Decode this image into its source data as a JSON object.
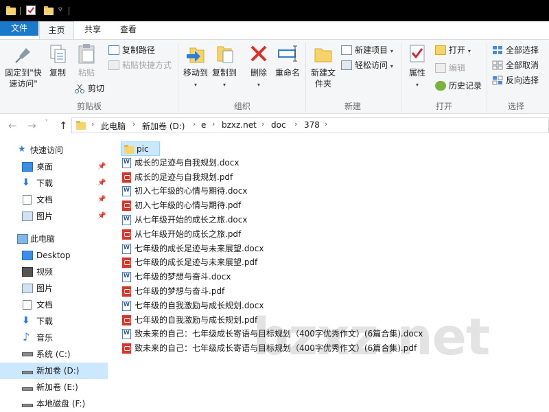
{
  "title_bar": {
    "icons": [
      "folder-icon",
      "properties-check-icon",
      "new-folder-icon",
      "customize-dropdown-icon"
    ]
  },
  "tabs": [
    {
      "label": "文件"
    },
    {
      "label": "主页"
    },
    {
      "label": "共享"
    },
    {
      "label": "查看"
    }
  ],
  "ribbon": {
    "clipboard": {
      "pin_quick_access": "固定到\"快速访问\"",
      "copy": "复制",
      "paste": "粘贴",
      "copy_path": "复制路径",
      "paste_shortcut": "粘贴快捷方式",
      "cut": "剪切",
      "group": "剪贴板"
    },
    "organize": {
      "move_to": "移动到",
      "copy_to": "复制到",
      "delete": "删除",
      "rename": "重命名",
      "group": "组织"
    },
    "new": {
      "new_folder": "新建文件夹",
      "new_item": "新建项目",
      "easy_access": "轻松访问",
      "group": "新建"
    },
    "open": {
      "properties": "属性",
      "open": "打开",
      "edit": "编辑",
      "history": "历史记录",
      "group": "打开"
    },
    "select": {
      "select_all": "全部选择",
      "select_none": "全部取消",
      "invert": "反向选择",
      "group": "选择"
    }
  },
  "address": {
    "back": "←",
    "forward": "→",
    "recent": "˅",
    "up": "↑",
    "crumbs": [
      "此电脑",
      "新加卷 (D:)",
      "e",
      "bzxz.net",
      "doc",
      "378"
    ]
  },
  "nav": {
    "quick_access": "快速访问",
    "desktop": "桌面",
    "downloads": "下载",
    "documents": "文档",
    "pictures": "图片",
    "this_pc": "此电脑",
    "pc_desktop": "Desktop",
    "videos": "视频",
    "pc_pictures": "图片",
    "pc_documents": "文档",
    "pc_downloads": "下载",
    "music": "音乐",
    "drive_c": "系统 (C:)",
    "drive_d": "新加卷 (D:)",
    "drive_e": "新加卷 (E:)",
    "drive_f": "本地磁盘 (F:)"
  },
  "files": [
    {
      "name": "pic",
      "type": "folder"
    },
    {
      "name": "成长的足迹与自我规划.docx",
      "type": "docx"
    },
    {
      "name": "成长的足迹与自我规划.pdf",
      "type": "pdf"
    },
    {
      "name": "初入七年级的心情与期待.docx",
      "type": "docx"
    },
    {
      "name": "初入七年级的心情与期待.pdf",
      "type": "pdf"
    },
    {
      "name": "从七年级开始的成长之旅.docx",
      "type": "docx"
    },
    {
      "name": "从七年级开始的成长之旅.pdf",
      "type": "pdf"
    },
    {
      "name": "七年级的成长足迹与未来展望.docx",
      "type": "docx"
    },
    {
      "name": "七年级的成长足迹与未来展望.pdf",
      "type": "pdf"
    },
    {
      "name": "七年级的梦想与奋斗.docx",
      "type": "docx"
    },
    {
      "name": "七年级的梦想与奋斗.pdf",
      "type": "pdf"
    },
    {
      "name": "七年级的自我激励与成长规划.docx",
      "type": "docx"
    },
    {
      "name": "七年级的自我激励与成长规划.pdf",
      "type": "pdf"
    },
    {
      "name": "致未来的自己：七年级成长寄语与目标规划（400字优秀作文）(6篇合集).docx",
      "type": "docx"
    },
    {
      "name": "致未来的自己：七年级成长寄语与目标规划（400字优秀作文）(6篇合集).pdf",
      "type": "pdf"
    }
  ],
  "watermark": "bzxz.net"
}
